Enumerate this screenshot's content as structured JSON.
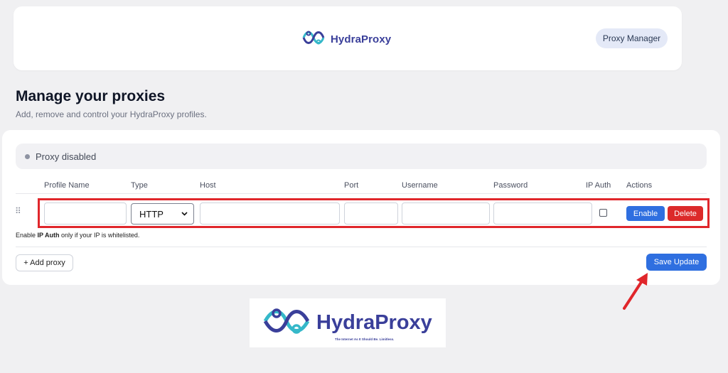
{
  "header": {
    "brand_name": "HydraProxy",
    "brand_icon": "hydra-knot-icon",
    "nav_button": "Proxy Manager"
  },
  "page": {
    "title": "Manage your proxies",
    "subtitle": "Add, remove and control your HydraProxy profiles."
  },
  "status": {
    "text": "Proxy disabled",
    "dot_color": "#8e93a2"
  },
  "table": {
    "columns": [
      "Profile Name",
      "Type",
      "Host",
      "Port",
      "Username",
      "Password",
      "IP Auth",
      "Actions"
    ],
    "rows": [
      {
        "profile_name": "",
        "type": "HTTP",
        "host": "",
        "port": "",
        "username": "",
        "password": "",
        "ip_auth": false,
        "enable_label": "Enable",
        "delete_label": "Delete"
      }
    ]
  },
  "note": {
    "prefix": "Enable ",
    "bold": "IP Auth",
    "suffix": " only if your IP is whitelisted."
  },
  "footer": {
    "add_label": "+ Add proxy",
    "save_label": "Save Update"
  },
  "bottom_logo": {
    "name": "HydraProxy",
    "tagline": "The Internet As It Should Be. Limitless."
  },
  "colors": {
    "accent_blue": "#2f6fe0",
    "danger_red": "#dc2a2a",
    "brand_purple": "#3a3f9a",
    "brand_teal": "#35b8c9",
    "annotation_red": "#e0262b"
  }
}
